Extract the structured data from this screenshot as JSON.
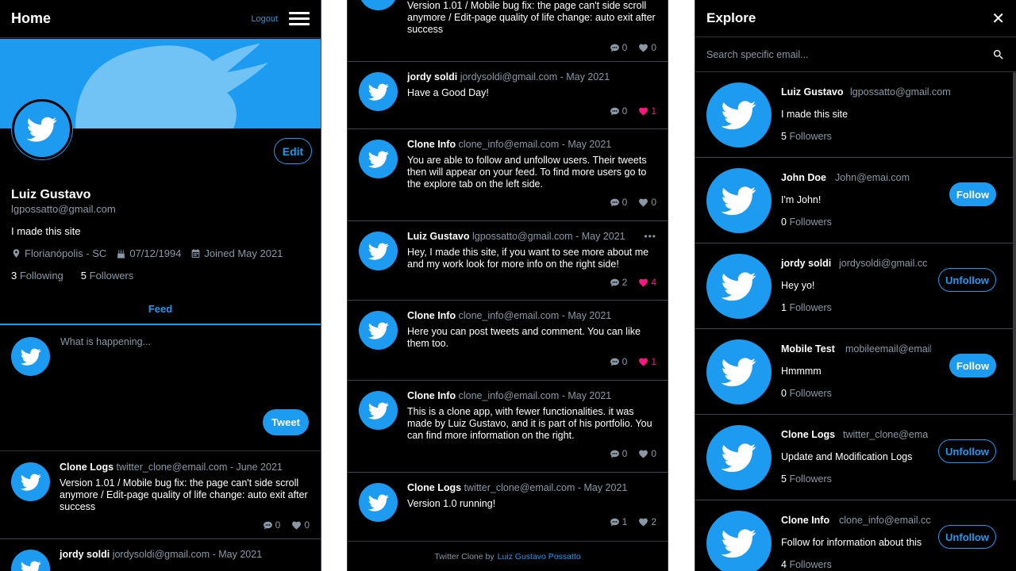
{
  "home": {
    "title": "Home",
    "logout": "Logout",
    "profile": {
      "name": "Luiz Gustavo",
      "email": "lgpossatto@gmail.com",
      "bio": "I made this site",
      "location": "Florianópolis - SC",
      "birthday": "07/12/1994",
      "joined": "Joined May 2021",
      "following_count": "3",
      "following_label": "Following",
      "followers_count": "5",
      "followers_label": "Followers",
      "edit_label": "Edit"
    },
    "feed_tab": "Feed",
    "compose": {
      "placeholder": "What is happening...",
      "button": "Tweet"
    },
    "tweets": [
      {
        "name": "Clone Logs",
        "meta": "twitter_clone@email.com - June 2021",
        "text": "Version 1.01 / Mobile bug fix: the page can't side scroll anymore / Edit-page quality of life change: auto exit after success",
        "comments": "0",
        "likes": "0"
      },
      {
        "name": "jordy soldi",
        "meta": "jordysoldi@gmail.com - May 2021"
      }
    ]
  },
  "feed": {
    "tweets": [
      {
        "text": "Version 1.01 / Mobile bug fix: the page can't side scroll anymore / Edit-page quality of life change: auto exit after success",
        "comments": "0",
        "likes": "0"
      },
      {
        "name": "jordy soldi",
        "meta": "jordysoldi@gmail.com - May 2021",
        "text": "Have a Good Day!",
        "comments": "0",
        "likes": "1"
      },
      {
        "name": "Clone Info",
        "meta": "clone_info@email.com - May 2021",
        "text": "You are able to follow and unfollow users. Their tweets then will appear on your feed. To find more users go to the explore tab on the left side.",
        "comments": "0",
        "likes": "0"
      },
      {
        "name": "Luiz Gustavo",
        "meta": "lgpossatto@gmail.com - May 2021",
        "text": "Hey, I made this site, if you want to see more about me and my work look for more info on the right side!",
        "comments": "2",
        "likes": "4"
      },
      {
        "name": "Clone Info",
        "meta": "clone_info@email.com - May 2021",
        "text": "Here you can post tweets and comment. You can like them too.",
        "comments": "0",
        "likes": "1"
      },
      {
        "name": "Clone Info",
        "meta": "clone_info@email.com - May 2021",
        "text": "This is a clone app, with fewer functionalities. it was made by Luiz Gustavo, and it is part of his portfolio. You can find more information on the right.",
        "comments": "0",
        "likes": "0"
      },
      {
        "name": "Clone Logs",
        "meta": "twitter_clone@email.com - May 2021",
        "text": "Version 1.0 running!",
        "comments": "1",
        "likes": "2"
      }
    ],
    "footer_prefix": "Twitter Clone by",
    "footer_link": "Luiz Gustavo Possatto"
  },
  "explore": {
    "title": "Explore",
    "close": "✕",
    "search_placeholder": "Search specific email...",
    "users": [
      {
        "name": "Luiz Gustavo",
        "email": "lgpossatto@gmail.com",
        "bio": "I made this site",
        "followers": "5",
        "followers_label": "Followers",
        "button": ""
      },
      {
        "name": "John Doe",
        "email": "John@emai.com",
        "bio": "I'm John!",
        "followers": "0",
        "followers_label": "Followers",
        "button": "Follow"
      },
      {
        "name": "jordy soldi",
        "email": "jordysoldi@gmail.cc",
        "bio": "Hey yo!",
        "followers": "1",
        "followers_label": "Followers",
        "button": "Unfollow"
      },
      {
        "name": "Mobile Test",
        "email": "mobileemail@email.c",
        "bio": "Hmmmm",
        "followers": "0",
        "followers_label": "Followers",
        "button": "Follow"
      },
      {
        "name": "Clone Logs",
        "email": "twitter_clone@ema",
        "bio": "Update and Modification Logs",
        "followers": "5",
        "followers_label": "Followers",
        "button": "Unfollow"
      },
      {
        "name": "Clone Info",
        "email": "clone_info@email.cc",
        "bio": "Follow for information about this",
        "followers": "4",
        "followers_label": "Followers",
        "button": "Unfollow"
      }
    ]
  },
  "colors": {
    "accent": "#1d9bf0",
    "like": "#f91880",
    "muted": "#8b98a5",
    "bg": "#000000"
  }
}
